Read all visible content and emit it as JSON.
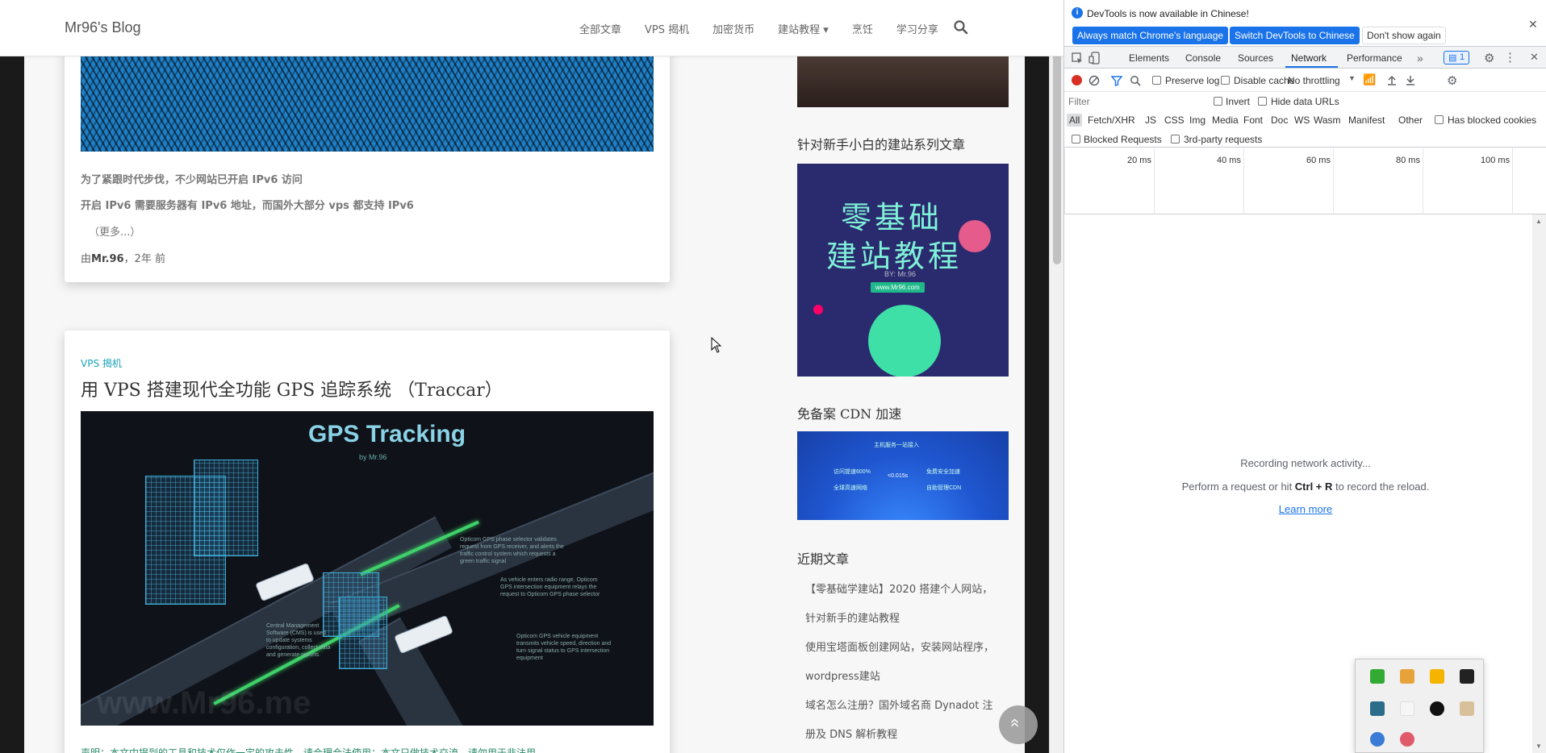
{
  "blog": {
    "brand": "Mr96's Blog",
    "menu": [
      "全部文章",
      "VPS 揭机",
      "加密货币",
      "建站教程 ▾",
      "烹饪",
      "学习分享"
    ],
    "post1": {
      "excerpt1": "为了紧跟时代步伐，不少网站已开启 IPv6 访问",
      "excerpt2": "开启 IPv6 需要服务器有 IPv6 地址，而国外大部分 vps 都支持 IPv6",
      "more": "（更多...）",
      "meta_prefix": "由",
      "author": "Mr.96",
      "meta_suffix": "，2年 前"
    },
    "post2": {
      "category": "VPS 揭机",
      "title": "用 VPS 搭建现代全功能 GPS 追踪系统 （Traccar）",
      "image_title": "GPS Tracking",
      "image_sub": "by Mr.96",
      "image_watermark": "www.Mr96.me",
      "note1": "Opticom GPS phase selector validates request from GPS receiver, and alerts the traffic control system which requests a green traffic signal",
      "note2": "As vehicle enters radio range, Opticom GPS intersection equipment relays the request to Opticom GPS phase selector",
      "note3": "Opticom GPS vehicle equipment transmits vehicle speed, direction and turn signal status to GPS intersection equipment",
      "note_cms": "Central Management Software (CMS) is used to update systems configuration, collect data and generate reports.",
      "cms": "CMS",
      "notice": "声明：本文中提到的工具和技术仅作一定的攻击性，请合理合法使用；本文只做技术交流，请勿用于非法用"
    },
    "sidebar": {
      "h_series": "针对新手小白的建站系列文章",
      "banner1_line1": "零基础",
      "banner1_line2": "建站教程",
      "banner1_by": "BY: Mr.96",
      "banner1_url": "www.Mr96.com",
      "h_cdn": "免备案 CDN 加速",
      "cdn_texts": [
        "主机服务一站接入",
        "访问提速600%",
        "全球高速网络",
        "免费安全加速",
        "自助管理CDN",
        "<0.015s"
      ],
      "h_recent": "近期文章",
      "recent": [
        "【零基础学建站】2020 搭建个人网站，",
        "针对新手的建站教程",
        "使用宝塔面板创建网站，安装网站程序，",
        "wordpress建站",
        "域名怎么注册？国外域名商 Dynadot 注",
        "册及 DNS 解析教程"
      ]
    },
    "back_to_top": "»"
  },
  "devtools": {
    "info_message": "DevTools is now available in Chinese!",
    "btn_match": "Always match Chrome's language",
    "btn_switch": "Switch DevTools to Chinese",
    "btn_dont": "Don't show again",
    "tabs": [
      "Elements",
      "Console",
      "Sources",
      "Network",
      "Performance"
    ],
    "active_tab": "Network",
    "more_tabs": "»",
    "issues_badge": "1",
    "toolbar": {
      "preserve_log": "Preserve log",
      "disable_cache": "Disable cache",
      "throttling": "No throttling"
    },
    "filter_placeholder": "Filter",
    "invert": "Invert",
    "hide_data_urls": "Hide data URLs",
    "types": [
      "All",
      "Fetch/XHR",
      "JS",
      "CSS",
      "Img",
      "Media",
      "Font",
      "Doc",
      "WS",
      "Wasm",
      "Manifest",
      "Other"
    ],
    "has_blocked_cookies": "Has blocked cookies",
    "blocked_requests": "Blocked Requests",
    "third_party": "3rd-party requests",
    "timeline_labels": [
      "20 ms",
      "40 ms",
      "60 ms",
      "80 ms",
      "100 ms"
    ],
    "empty_line1": "Recording network activity...",
    "empty_line2_pre": "Perform a request or hit ",
    "empty_line2_key": "Ctrl + R",
    "empty_line2_post": " to record the reload.",
    "learn_more": "Learn more"
  },
  "colors": {
    "accent": "#1a73e8",
    "category": "#1aa2b8",
    "record": "#d93025"
  }
}
